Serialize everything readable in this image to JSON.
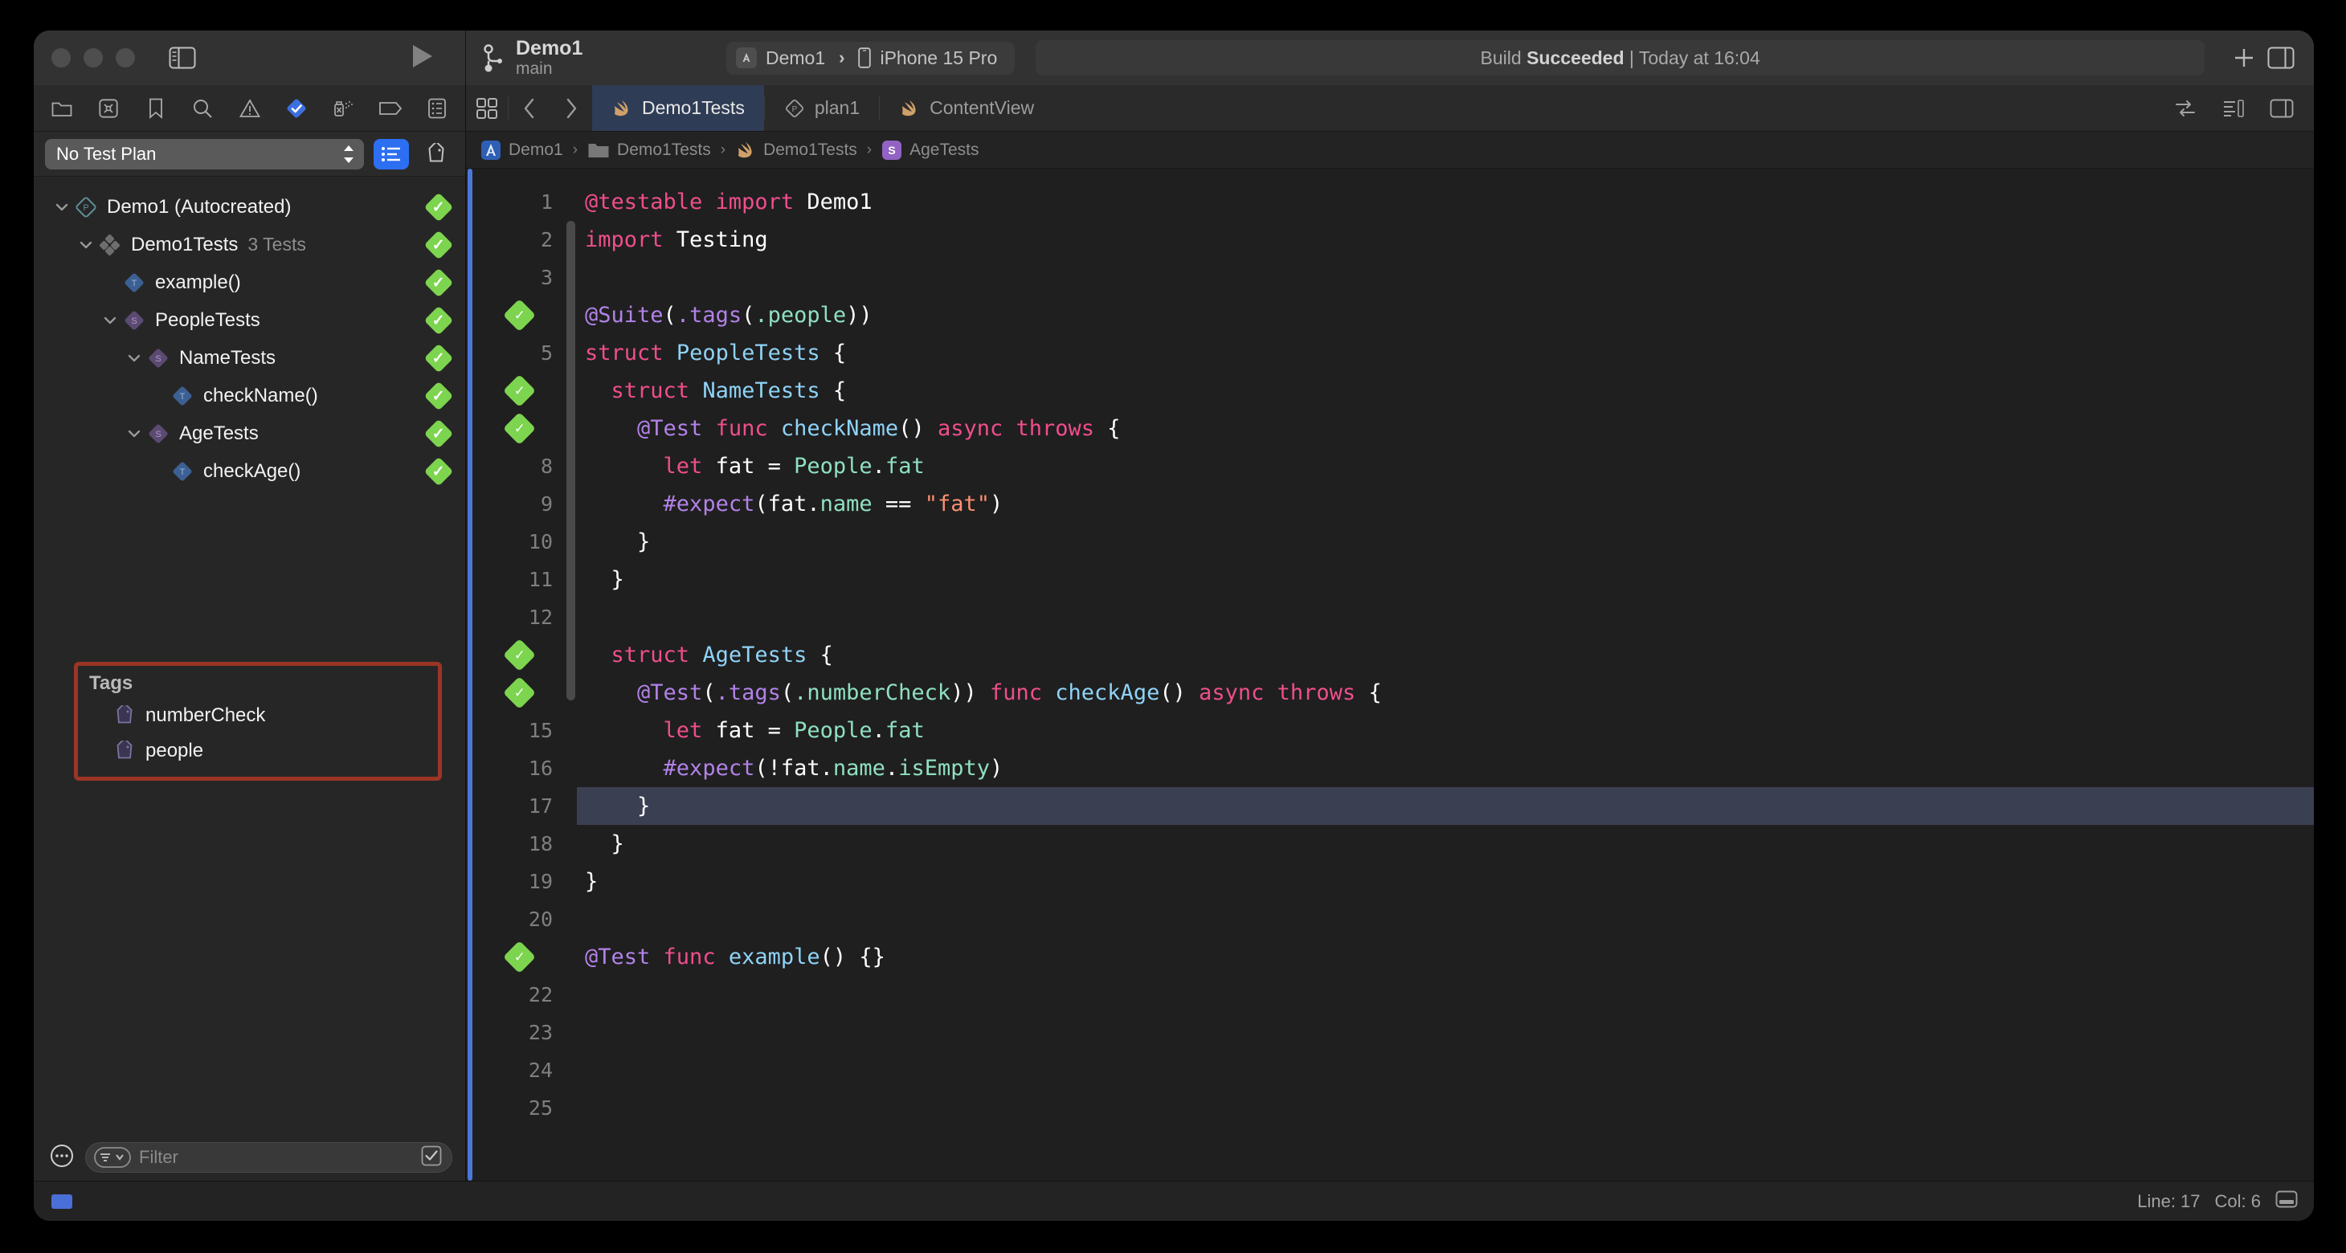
{
  "window": {
    "traffic_lights": [
      "close",
      "minimize",
      "zoom"
    ]
  },
  "toolbar": {
    "branch_title": "Demo1",
    "branch_subtitle": "main",
    "scheme_name": "Demo1",
    "device_name": "iPhone 15 Pro",
    "status_prefix": "Build ",
    "status_result": "Succeeded",
    "status_suffix": " | Today at 16:04",
    "run_button": "run",
    "add_button": "+",
    "inspector_toggle": "inspector",
    "sidebar_toggle": "sidebar"
  },
  "navigator": {
    "icons": [
      {
        "name": "folder-icon",
        "label": "Project navigator"
      },
      {
        "name": "source-control-icon",
        "label": "Source control navigator"
      },
      {
        "name": "bookmark-icon",
        "label": "Bookmark navigator"
      },
      {
        "name": "search-icon",
        "label": "Find navigator"
      },
      {
        "name": "warning-triangle-icon",
        "label": "Issue navigator"
      },
      {
        "name": "test-diamond-icon",
        "label": "Test navigator"
      },
      {
        "name": "debug-icon",
        "label": "Debug navigator"
      },
      {
        "name": "breakpoint-icon",
        "label": "Breakpoint navigator"
      },
      {
        "name": "report-icon",
        "label": "Report navigator"
      }
    ],
    "test_plan_value": "No Test Plan",
    "list_view_button": "list-view",
    "tag-view_button": "tag-view",
    "tree": [
      {
        "label": "Demo1 (Autocreated)",
        "sub": "",
        "icon": "plan-icon",
        "depth": 0,
        "twisty": "down",
        "status": "passed"
      },
      {
        "label": "Demo1Tests",
        "sub": "3 Tests",
        "icon": "bundle-icon",
        "depth": 1,
        "twisty": "down",
        "status": "passed"
      },
      {
        "label": "example()",
        "sub": "",
        "icon": "test-icon",
        "depth": 2,
        "twisty": "",
        "status": "passed"
      },
      {
        "label": "PeopleTests",
        "sub": "",
        "icon": "suite-icon",
        "depth": 2,
        "twisty": "down",
        "status": "passed"
      },
      {
        "label": "NameTests",
        "sub": "",
        "icon": "suite-icon",
        "depth": 3,
        "twisty": "down",
        "status": "passed"
      },
      {
        "label": "checkName()",
        "sub": "",
        "icon": "test-icon",
        "depth": 4,
        "twisty": "",
        "status": "passed"
      },
      {
        "label": "AgeTests",
        "sub": "",
        "icon": "suite-icon",
        "depth": 3,
        "twisty": "down",
        "status": "passed"
      },
      {
        "label": "checkAge()",
        "sub": "",
        "icon": "test-icon",
        "depth": 4,
        "twisty": "",
        "status": "passed"
      }
    ],
    "tags_section": {
      "title": "Tags",
      "highlight_color": "#9b3526",
      "items": [
        {
          "label": "numberCheck",
          "icon": "tag-icon"
        },
        {
          "label": "people",
          "icon": "tag-icon"
        }
      ]
    },
    "filter_placeholder": "Filter",
    "options_button": "…"
  },
  "editor": {
    "tabs": [
      {
        "label": "Demo1Tests",
        "icon": "swift-icon",
        "active": true
      },
      {
        "label": "plan1",
        "icon": "plan-icon",
        "active": false
      },
      {
        "label": "ContentView",
        "icon": "swift-icon",
        "active": false
      }
    ],
    "breadcrumbs": [
      {
        "label": "Demo1",
        "icon": "app-icon"
      },
      {
        "label": "Demo1Tests",
        "icon": "folder-icon"
      },
      {
        "label": "Demo1Tests",
        "icon": "swift-icon"
      },
      {
        "label": "AgeTests",
        "icon": "struct-icon"
      }
    ],
    "breadcrumb_separator": "›",
    "current_line": 17,
    "lines": [
      {
        "n": 1,
        "status": "",
        "tokens": [
          {
            "t": "@testable import",
            "c": "k"
          },
          {
            "t": " ",
            "c": "pl"
          },
          {
            "t": "Demo1",
            "c": "pl"
          }
        ]
      },
      {
        "n": 2,
        "status": "",
        "tokens": [
          {
            "t": "import",
            "c": "k"
          },
          {
            "t": " Testing",
            "c": "pl"
          }
        ]
      },
      {
        "n": 3,
        "status": "",
        "tokens": []
      },
      {
        "n": 4,
        "status": "passed",
        "tokens": [
          {
            "t": "@Suite",
            "c": "at"
          },
          {
            "t": "(",
            "c": "pl"
          },
          {
            "t": ".tags",
            "c": "at"
          },
          {
            "t": "(",
            "c": "pl"
          },
          {
            "t": ".people",
            "c": "mb"
          },
          {
            "t": "))",
            "c": "pl"
          }
        ]
      },
      {
        "n": 5,
        "status": "",
        "tokens": [
          {
            "t": "struct",
            "c": "k"
          },
          {
            "t": " ",
            "c": "pl"
          },
          {
            "t": "PeopleTests",
            "c": "ty"
          },
          {
            "t": " {",
            "c": "pl"
          }
        ]
      },
      {
        "n": 6,
        "status": "passed",
        "tokens": [
          {
            "t": "  ",
            "c": "pl"
          },
          {
            "t": "struct",
            "c": "k"
          },
          {
            "t": " ",
            "c": "pl"
          },
          {
            "t": "NameTests",
            "c": "ty"
          },
          {
            "t": " {",
            "c": "pl"
          }
        ]
      },
      {
        "n": 7,
        "status": "passed",
        "tokens": [
          {
            "t": "    ",
            "c": "pl"
          },
          {
            "t": "@Test",
            "c": "at"
          },
          {
            "t": " ",
            "c": "pl"
          },
          {
            "t": "func",
            "c": "k"
          },
          {
            "t": " ",
            "c": "pl"
          },
          {
            "t": "checkName",
            "c": "ty"
          },
          {
            "t": "() ",
            "c": "pl"
          },
          {
            "t": "async throws",
            "c": "k"
          },
          {
            "t": " {",
            "c": "pl"
          }
        ]
      },
      {
        "n": 8,
        "status": "",
        "tokens": [
          {
            "t": "      ",
            "c": "pl"
          },
          {
            "t": "let",
            "c": "k"
          },
          {
            "t": " fat = ",
            "c": "pl"
          },
          {
            "t": "People",
            "c": "mb"
          },
          {
            "t": ".",
            "c": "pl"
          },
          {
            "t": "fat",
            "c": "mb"
          }
        ]
      },
      {
        "n": 9,
        "status": "",
        "tokens": [
          {
            "t": "      ",
            "c": "pl"
          },
          {
            "t": "#expect",
            "c": "at"
          },
          {
            "t": "(fat.",
            "c": "pl"
          },
          {
            "t": "name",
            "c": "mb"
          },
          {
            "t": " == ",
            "c": "pl"
          },
          {
            "t": "\"fat\"",
            "c": "st"
          },
          {
            "t": ")",
            "c": "pl"
          }
        ]
      },
      {
        "n": 10,
        "status": "",
        "tokens": [
          {
            "t": "    }",
            "c": "pl"
          }
        ]
      },
      {
        "n": 11,
        "status": "",
        "tokens": [
          {
            "t": "  }",
            "c": "pl"
          }
        ]
      },
      {
        "n": 12,
        "status": "",
        "tokens": []
      },
      {
        "n": 13,
        "status": "passed",
        "tokens": [
          {
            "t": "  ",
            "c": "pl"
          },
          {
            "t": "struct",
            "c": "k"
          },
          {
            "t": " ",
            "c": "pl"
          },
          {
            "t": "AgeTests",
            "c": "ty"
          },
          {
            "t": " {",
            "c": "pl"
          }
        ]
      },
      {
        "n": 14,
        "status": "passed",
        "tokens": [
          {
            "t": "    ",
            "c": "pl"
          },
          {
            "t": "@Test",
            "c": "at"
          },
          {
            "t": "(",
            "c": "pl"
          },
          {
            "t": ".tags",
            "c": "at"
          },
          {
            "t": "(",
            "c": "pl"
          },
          {
            "t": ".numberCheck",
            "c": "mb"
          },
          {
            "t": ")) ",
            "c": "pl"
          },
          {
            "t": "func",
            "c": "k"
          },
          {
            "t": " ",
            "c": "pl"
          },
          {
            "t": "checkAge",
            "c": "ty"
          },
          {
            "t": "() ",
            "c": "pl"
          },
          {
            "t": "async throws",
            "c": "k"
          },
          {
            "t": " {",
            "c": "pl"
          }
        ]
      },
      {
        "n": 15,
        "status": "",
        "tokens": [
          {
            "t": "      ",
            "c": "pl"
          },
          {
            "t": "let",
            "c": "k"
          },
          {
            "t": " fat = ",
            "c": "pl"
          },
          {
            "t": "People",
            "c": "mb"
          },
          {
            "t": ".",
            "c": "pl"
          },
          {
            "t": "fat",
            "c": "mb"
          }
        ]
      },
      {
        "n": 16,
        "status": "",
        "tokens": [
          {
            "t": "      ",
            "c": "pl"
          },
          {
            "t": "#expect",
            "c": "at"
          },
          {
            "t": "(!fat.",
            "c": "pl"
          },
          {
            "t": "name",
            "c": "mb"
          },
          {
            "t": ".",
            "c": "pl"
          },
          {
            "t": "isEmpty",
            "c": "mb"
          },
          {
            "t": ")",
            "c": "pl"
          }
        ]
      },
      {
        "n": 17,
        "status": "",
        "tokens": [
          {
            "t": "    }",
            "c": "pl"
          }
        ],
        "current": true
      },
      {
        "n": 18,
        "status": "",
        "tokens": [
          {
            "t": "  }",
            "c": "pl"
          }
        ]
      },
      {
        "n": 19,
        "status": "",
        "tokens": [
          {
            "t": "}",
            "c": "pl"
          }
        ]
      },
      {
        "n": 20,
        "status": "",
        "tokens": []
      },
      {
        "n": 21,
        "status": "passed",
        "tokens": [
          {
            "t": "@Test",
            "c": "at"
          },
          {
            "t": " ",
            "c": "pl"
          },
          {
            "t": "func",
            "c": "k"
          },
          {
            "t": " ",
            "c": "pl"
          },
          {
            "t": "example",
            "c": "ty"
          },
          {
            "t": "() {}",
            "c": "pl"
          }
        ]
      },
      {
        "n": 22,
        "status": "",
        "tokens": []
      },
      {
        "n": 23,
        "status": "",
        "tokens": []
      },
      {
        "n": 24,
        "status": "",
        "tokens": []
      },
      {
        "n": 25,
        "status": "",
        "tokens": []
      }
    ]
  },
  "statusbar": {
    "line_label": "Line: 17",
    "col_label": "Col: 6",
    "minimap_button": "minimap"
  },
  "colors": {
    "accent": "#2d6ff2",
    "pass_green": "#7dd44f",
    "highlight_red": "#9b3526",
    "editor_bg": "#1f1f1f",
    "chrome_bg": "#333232",
    "nav_bg": "#272626"
  }
}
